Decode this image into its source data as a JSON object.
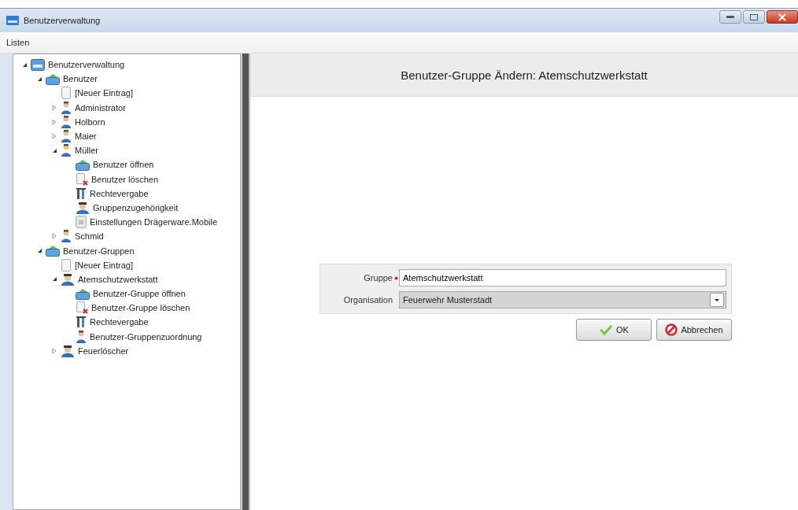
{
  "window": {
    "title": "Benutzerverwaltung"
  },
  "menu": [
    {
      "label": "Listen"
    }
  ],
  "tree": [
    {
      "label": "Benutzerverwaltung",
      "kind": "root",
      "expanded": true,
      "children": [
        {
          "label": "Benutzer",
          "kind": "folder",
          "expanded": true,
          "children": [
            {
              "label": "[Neuer Eintrag]",
              "kind": "new"
            },
            {
              "label": "Administrator",
              "kind": "user",
              "expanded": false
            },
            {
              "label": "Holborn",
              "kind": "user",
              "expanded": false
            },
            {
              "label": "Maier",
              "kind": "user",
              "expanded": false
            },
            {
              "label": "Müller",
              "kind": "user",
              "expanded": true,
              "children": [
                {
                  "label": "Benutzer öffnen",
                  "kind": "open"
                },
                {
                  "label": "Benutzer löschen",
                  "kind": "delete"
                },
                {
                  "label": "Rechtevergabe",
                  "kind": "rights"
                },
                {
                  "label": "Gruppenzugehörigkeit",
                  "kind": "group"
                },
                {
                  "label": "Einstellungen Drägerware.Mobile",
                  "kind": "settings"
                }
              ]
            },
            {
              "label": "Schmid",
              "kind": "user",
              "expanded": false
            }
          ]
        },
        {
          "label": "Benutzer-Gruppen",
          "kind": "folder",
          "expanded": true,
          "children": [
            {
              "label": "[Neuer Eintrag]",
              "kind": "new"
            },
            {
              "label": "Atemschutzwerkstatt",
              "kind": "group",
              "expanded": true,
              "children": [
                {
                  "label": "Benutzer-Gruppe öffnen",
                  "kind": "open"
                },
                {
                  "label": "Benutzer-Gruppe löschen",
                  "kind": "delete"
                },
                {
                  "label": "Rechtevergabe",
                  "kind": "rights"
                },
                {
                  "label": "Benutzer-Gruppenzuordnung",
                  "kind": "user"
                }
              ]
            },
            {
              "label": "Feuerlöscher",
              "kind": "group",
              "expanded": false
            }
          ]
        }
      ]
    }
  ],
  "form": {
    "heading": "Benutzer-Gruppe Ändern: Atemschutzwerkstatt",
    "fields": [
      {
        "label": "Gruppe",
        "kind": "text",
        "required": true,
        "value": "Atemschutzwerkstatt"
      },
      {
        "label": "Organisation",
        "kind": "dropdown",
        "required": false,
        "value": "Feuerwehr Musterstadt"
      }
    ],
    "buttons": [
      {
        "label": "OK",
        "kind": "ok"
      },
      {
        "label": "Abbrechen",
        "kind": "cancel"
      }
    ]
  }
}
